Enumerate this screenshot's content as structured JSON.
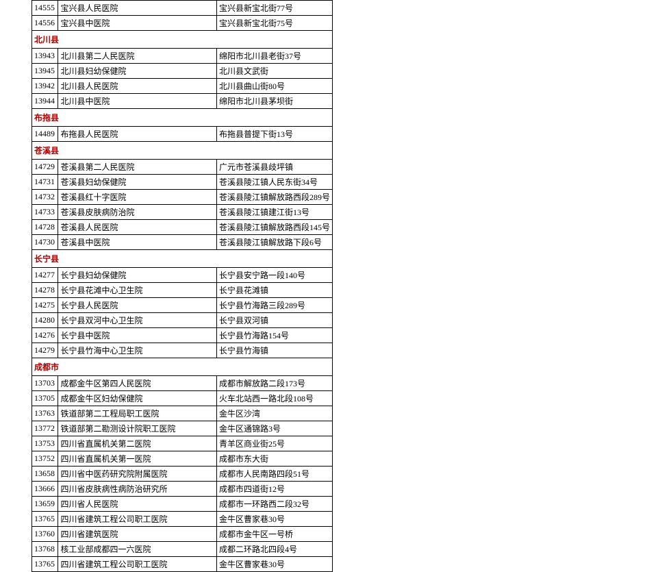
{
  "groups": [
    {
      "region": null,
      "rows": [
        {
          "id": "14555",
          "name": "宝兴县人民医院",
          "addr": "宝兴县新宝北街77号"
        },
        {
          "id": "14556",
          "name": "宝兴县中医院",
          "addr": "宝兴县新宝北街75号"
        }
      ]
    },
    {
      "region": "北川县",
      "rows": [
        {
          "id": "13943",
          "name": "北川县第二人民医院",
          "addr": "绵阳市北川县老街37号"
        },
        {
          "id": "13945",
          "name": "北川县妇幼保健院",
          "addr": "北川县文武街"
        },
        {
          "id": "13942",
          "name": "北川县人民医院",
          "addr": "北川县曲山街80号"
        },
        {
          "id": "13944",
          "name": "北川县中医院",
          "addr": "绵阳市北川县茅坝街"
        }
      ]
    },
    {
      "region": "布拖县",
      "rows": [
        {
          "id": "14489",
          "name": "布拖县人民医院",
          "addr": "布拖县普提下街13号"
        }
      ]
    },
    {
      "region": "苍溪县",
      "rows": [
        {
          "id": "14729",
          "name": "苍溪县第二人民医院",
          "addr": "广元市苍溪县歧坪镇"
        },
        {
          "id": "14731",
          "name": "苍溪县妇幼保健院",
          "addr": "苍溪县陵江镇人民东街34号"
        },
        {
          "id": "14732",
          "name": "苍溪县红十字医院",
          "addr": "苍溪县陵江镇解放路西段289号"
        },
        {
          "id": "14733",
          "name": "苍溪县皮肤病防治院",
          "addr": "苍溪县陵江镇建江街13号"
        },
        {
          "id": "14728",
          "name": "苍溪县人民医院",
          "addr": "苍溪县陵江镇解放路西段145号"
        },
        {
          "id": "14730",
          "name": "苍溪县中医院",
          "addr": "苍溪县陵江镇解放路下段6号"
        }
      ]
    },
    {
      "region": "长宁县",
      "rows": [
        {
          "id": "14277",
          "name": "长宁县妇幼保健院",
          "addr": "长宁县安宁路一段140号"
        },
        {
          "id": "14278",
          "name": "长宁县花滩中心卫生院",
          "addr": "长宁县花滩镇"
        },
        {
          "id": "14275",
          "name": "长宁县人民医院",
          "addr": "长宁县竹海路三段289号"
        },
        {
          "id": "14280",
          "name": "长宁县双河中心卫生院",
          "addr": "长宁县双河镇"
        },
        {
          "id": "14276",
          "name": "长宁县中医院",
          "addr": "长宁县竹海路154号"
        },
        {
          "id": "14279",
          "name": "长宁县竹海中心卫生院",
          "addr": "长宁县竹海镇"
        }
      ]
    },
    {
      "region": "成都市",
      "rows": [
        {
          "id": "13703",
          "name": "成都金牛区第四人民医院",
          "addr": "成都市解放路二段173号"
        },
        {
          "id": "13705",
          "name": "成都金牛区妇幼保健院",
          "addr": "火车北站西一路北段108号"
        },
        {
          "id": "13763",
          "name": "铁道部第二工程局职工医院",
          "addr": "金牛区沙湾"
        },
        {
          "id": "13772",
          "name": "铁道部第二勘测设计院职工医院",
          "addr": "金牛区通锦路3号"
        },
        {
          "id": "13753",
          "name": "四川省直属机关第二医院",
          "addr": "青羊区商业街25号"
        },
        {
          "id": "13752",
          "name": "四川省直属机关第一医院",
          "addr": "成都市东大街"
        },
        {
          "id": "13658",
          "name": "四川省中医药研究院附属医院",
          "addr": "成都市人民南路四段51号"
        },
        {
          "id": "13666",
          "name": "四川省皮肤病性病防治研究所",
          "addr": "成都市四道街12号"
        },
        {
          "id": "13659",
          "name": "四川省人民医院",
          "addr": "成都市一环路西二段32号"
        },
        {
          "id": "13765",
          "name": "四川省建筑工程公司职工医院",
          "addr": "金牛区曹家巷30号"
        },
        {
          "id": "13760",
          "name": "四川省建筑医院",
          "addr": "成都市金牛区一号桥"
        },
        {
          "id": "13768",
          "name": "核工业部成都四一六医院",
          "addr": "成都二环路北四段4号"
        },
        {
          "id": "13765",
          "name": "四川省建筑工程公司职工医院",
          "addr": "金牛区曹家巷30号"
        }
      ]
    }
  ]
}
